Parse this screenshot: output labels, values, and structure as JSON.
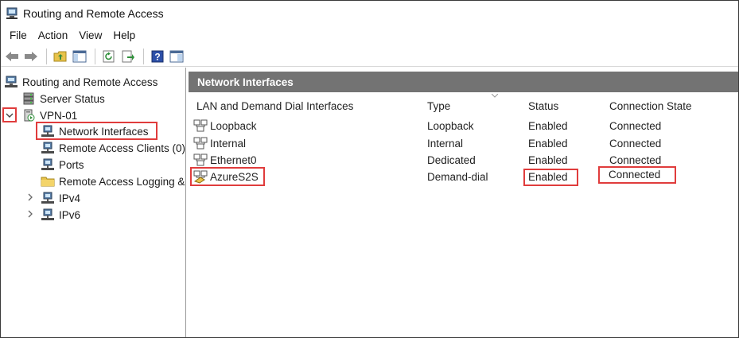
{
  "window": {
    "title": "Routing and Remote Access"
  },
  "menu": [
    "File",
    "Action",
    "View",
    "Help"
  ],
  "toolbar": {
    "buttons": [
      "back-icon",
      "forward-icon",
      "up-folder-icon",
      "show-hide-tree-icon",
      "refresh-icon",
      "export-list-icon",
      "help-icon",
      "properties-pane-icon"
    ]
  },
  "tree": {
    "root": "Routing and Remote Access",
    "server_status": "Server Status",
    "server": "VPN-01",
    "children": [
      "Network Interfaces",
      "Remote Access Clients (0)",
      "Ports",
      "Remote Access Logging &",
      "IPv4",
      "IPv6"
    ]
  },
  "pane": {
    "title": "Network Interfaces",
    "columns": [
      "LAN and Demand Dial Interfaces",
      "Type",
      "Status",
      "Connection State"
    ],
    "rows": [
      {
        "name": "Loopback",
        "type": "Loopback",
        "status": "Enabled",
        "state": "Connected"
      },
      {
        "name": "Internal",
        "type": "Internal",
        "status": "Enabled",
        "state": "Connected"
      },
      {
        "name": "Ethernet0",
        "type": "Dedicated",
        "status": "Enabled",
        "state": "Connected"
      },
      {
        "name": "AzureS2S",
        "type": "Demand-dial",
        "status": "Enabled",
        "state": "Connected"
      }
    ]
  },
  "colors": {
    "highlight": "#e03c3c",
    "pane_header": "#737373"
  }
}
